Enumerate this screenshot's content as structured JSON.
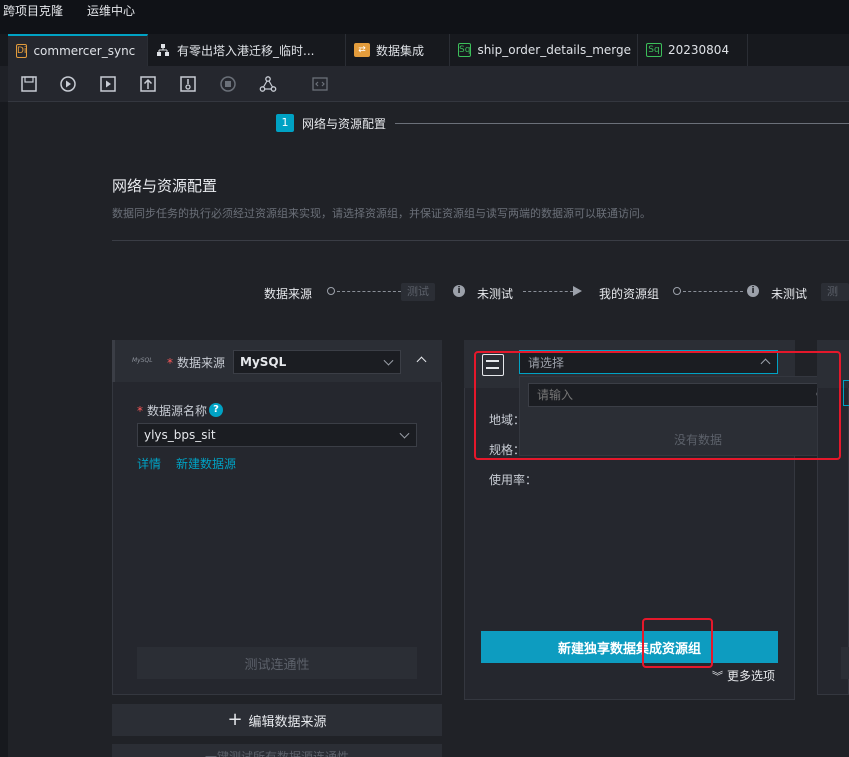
{
  "topmenu": {
    "items": [
      "跨项目克隆",
      "运维中心"
    ]
  },
  "tabs": [
    {
      "badge": "Di",
      "label": "commercer_sync",
      "badge_color": "#e39c3c"
    },
    {
      "label": "有零出塔入港迁移_临时..."
    },
    {
      "label": "数据集成"
    },
    {
      "badge": "Sq",
      "label": "ship_order_details_merge",
      "badge_color": "#3cbf5a"
    },
    {
      "badge": "Sq",
      "label": "20230804",
      "badge_color": "#3cbf5a"
    }
  ],
  "toolbar": {
    "icons": [
      "save-icon",
      "run-icon",
      "run-with-params-icon",
      "submit-icon",
      "publish-icon",
      "stop-icon",
      "dag-icon",
      "code-icon"
    ]
  },
  "step": {
    "number": "1",
    "label": "网络与资源配置"
  },
  "section": {
    "title": "网络与资源配置",
    "description": "数据同步任务的执行必须经过资源组来实现，请选择资源组，并保证资源组与读写两端的数据源可以联通访问。"
  },
  "flow": {
    "source_label": "数据来源",
    "test1": "测试",
    "untested1": "未测试",
    "resource_group_label": "我的资源组",
    "untested2": "未测试",
    "test2": "测试"
  },
  "source_panel": {
    "logo_text": "MySQL",
    "source_label": "数据来源",
    "source_value": "MySQL",
    "name_label": "数据源名称",
    "name_value": "ylys_bps_sit",
    "detail_link": "详情",
    "new_source_link": "新建数据源",
    "test_button": "测试连通性",
    "edit_button": "编辑数据来源",
    "bottom_button": "一键测试所有数据源连通性"
  },
  "resource_panel": {
    "select_placeholder": "请选择",
    "search_placeholder": "请输入",
    "no_data": "没有数据",
    "region_label": "地域：",
    "spec_label": "规格：",
    "usage_label": "使用率：",
    "create_button": "新建独享数据集成资源组",
    "more_options": "更多选项"
  },
  "colors": {
    "accent": "#00a2c4",
    "highlight": "#e5182b"
  }
}
